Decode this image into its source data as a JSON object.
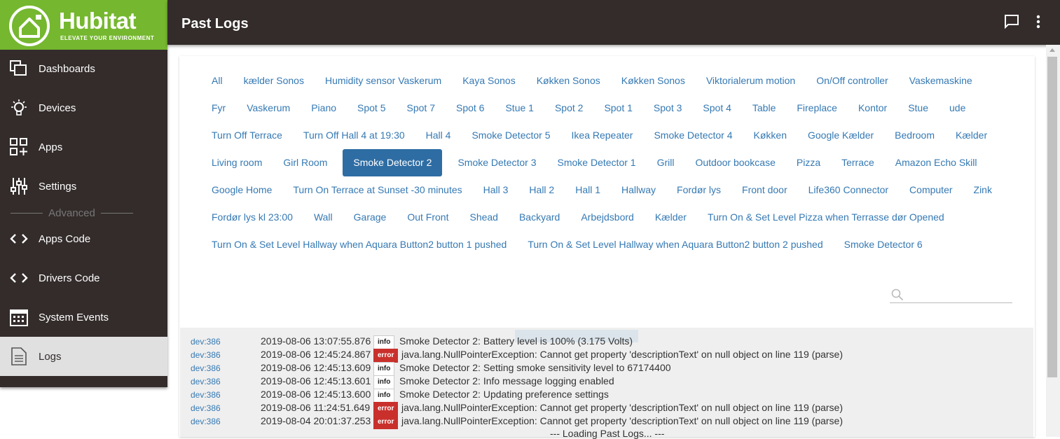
{
  "brand": {
    "name": "Hubitat",
    "tagline": "ELEVATE YOUR ENVIRONMENT",
    "color": "#75b72f"
  },
  "header": {
    "title": "Past Logs",
    "chat_icon": "chat-icon",
    "menu_icon": "more-vert-icon"
  },
  "sidebar": {
    "items": [
      {
        "label": "Dashboards",
        "icon": "dashboards-icon"
      },
      {
        "label": "Devices",
        "icon": "lightbulb-icon"
      },
      {
        "label": "Apps",
        "icon": "apps-icon"
      },
      {
        "label": "Settings",
        "icon": "sliders-icon"
      },
      {
        "label": "Apps Code",
        "icon": "code-icon"
      },
      {
        "label": "Drivers Code",
        "icon": "code-icon"
      },
      {
        "label": "System Events",
        "icon": "calendar-icon"
      },
      {
        "label": "Logs",
        "icon": "document-icon"
      }
    ],
    "advanced_label": "Advanced",
    "active": "Logs"
  },
  "filters": [
    "All",
    "kælder Sonos",
    "Humidity sensor Vaskerum",
    "Kaya Sonos",
    "Køkken Sonos",
    "Køkken Sonos",
    "Viktorialerum motion",
    "On/Off controller",
    "Vaskemaskine",
    "Fyr",
    "Vaskerum",
    "Piano",
    "Spot 5",
    "Spot 7",
    "Spot 6",
    "Stue 1",
    "Spot 2",
    "Spot 1",
    "Spot 3",
    "Spot 4",
    "Table",
    "Fireplace",
    "Kontor",
    "Stue",
    "ude",
    "Turn Off Terrace",
    "Turn Off Hall 4 at 19:30",
    "Hall 4",
    "Smoke Detector 5",
    "Ikea Repeater",
    "Smoke Detector 4",
    "Køkken",
    "Google Kælder",
    "Bedroom",
    "Kælder",
    "Living room",
    "Girl Room",
    "Smoke Detector 2",
    "Smoke Detector 3",
    "Smoke Detector 1",
    "Grill",
    "Outdoor bookcase",
    "Pizza",
    "Terrace",
    "Amazon Echo Skill",
    "Google Home",
    "Turn On Terrace at Sunset -30 minutes",
    "Hall 3",
    "Hall 2",
    "Hall 1",
    "Hallway",
    "Fordør lys",
    "Front door",
    "Life360 Connector",
    "Computer",
    "Zink",
    "Fordør lys kl 23:00",
    "Wall",
    "Garage",
    "Out Front",
    "Shead",
    "Backyard",
    "Arbejdsbord",
    "Kælder",
    "Turn On & Set Level Pizza when Terrasse dør Opened",
    "Turn On & Set Level Hallway when Aquara Button2 button 1 pushed",
    "Turn On & Set Level Hallway when Aquara Button2 button 2 pushed",
    "Smoke Detector 6"
  ],
  "selected_filter": "Smoke Detector 2",
  "search": {
    "value": "",
    "icon": "search-icon"
  },
  "logs": [
    {
      "dev": "dev:386",
      "time": "2019-08-06 13:07:55.876",
      "level": "info",
      "message": "Smoke Detector 2: Battery level is 100% (3.175 Volts)"
    },
    {
      "dev": "dev:386",
      "time": "2019-08-06 12:45:24.867",
      "level": "error",
      "message": "java.lang.NullPointerException: Cannot get property 'descriptionText' on null object on line 119 (parse)"
    },
    {
      "dev": "dev:386",
      "time": "2019-08-06 12:45:13.609",
      "level": "info",
      "message": "Smoke Detector 2: Setting smoke sensitivity level to 67174400"
    },
    {
      "dev": "dev:386",
      "time": "2019-08-06 12:45:13.601",
      "level": "info",
      "message": "Smoke Detector 2: Info message logging enabled"
    },
    {
      "dev": "dev:386",
      "time": "2019-08-06 12:45:13.600",
      "level": "info",
      "message": "Smoke Detector 2: Updating preference settings"
    },
    {
      "dev": "dev:386",
      "time": "2019-08-06 11:24:51.649",
      "level": "error",
      "message": "java.lang.NullPointerException: Cannot get property 'descriptionText' on null object on line 119 (parse)"
    },
    {
      "dev": "dev:386",
      "time": "2019-08-04 20:01:37.253",
      "level": "error",
      "message": "java.lang.NullPointerException: Cannot get property 'descriptionText' on null object on line 119 (parse)"
    }
  ],
  "loading_text": "--- Loading Past Logs... ---"
}
